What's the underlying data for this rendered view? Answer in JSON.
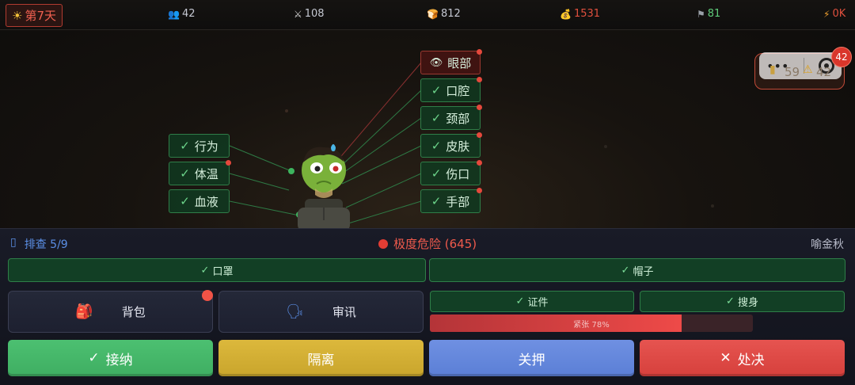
{
  "topbar": {
    "day": "第7天",
    "stats": [
      {
        "icon": "people-icon",
        "value": "42",
        "color": "#c5c8d2"
      },
      {
        "icon": "swords-icon",
        "value": "108",
        "color": "#c5c8d2"
      },
      {
        "icon": "bread-icon",
        "value": "812",
        "color": "#c5c8d2"
      },
      {
        "icon": "money-bag-icon",
        "value": "1531",
        "color": "#e0503e"
      },
      {
        "icon": "flag-icon",
        "value": "81",
        "color": "#5fcc7a"
      },
      {
        "icon": "lightning-icon",
        "value": "0K",
        "color": "#e0503e"
      }
    ]
  },
  "body_tags": {
    "left": [
      {
        "label": "行为",
        "alert": false
      },
      {
        "label": "体温",
        "alert": true
      },
      {
        "label": "血液",
        "alert": false
      }
    ],
    "right": [
      {
        "label": "眼部",
        "alert": true,
        "icon": "eye-icon"
      },
      {
        "label": "口腔",
        "alert": true
      },
      {
        "label": "颈部",
        "alert": true
      },
      {
        "label": "皮肤",
        "alert": true
      },
      {
        "label": "伤口",
        "alert": true
      },
      {
        "label": "手部",
        "alert": true
      }
    ]
  },
  "resource_chip": {
    "food": "59",
    "warning": "42",
    "badge": "42"
  },
  "panel": {
    "step_label": "排查 5/9",
    "danger_label": "极度危险 (645)",
    "person_name": "喻金秋",
    "check_mask": "口罩",
    "check_hat": "帽子",
    "backpack": "背包",
    "interrogate": "审讯",
    "check_id": "证件",
    "check_search": "搜身",
    "tension_label": "紧张 78%",
    "tension_value": 0.78,
    "accept": "接纳",
    "isolate": "隔离",
    "detain": "关押",
    "execute": "处决"
  },
  "colors": {
    "accept": "#3fae62",
    "isolate": "#c9a52c",
    "detain": "#5b7fd6",
    "execute": "#d6403c",
    "danger": "#e23d34"
  }
}
